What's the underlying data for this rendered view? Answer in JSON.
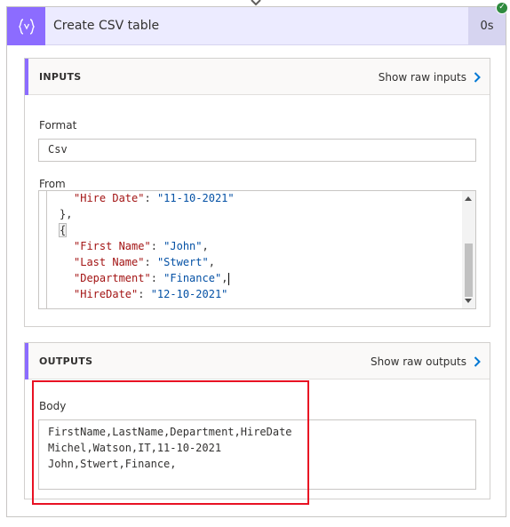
{
  "action": {
    "title": "Create CSV table",
    "duration": "0s",
    "icon": "curly-braces-variable-icon",
    "accent_color": "#8c6cff",
    "status": "succeeded",
    "status_color": "#2e8a3e"
  },
  "inputs": {
    "section_title": "INPUTS",
    "raw_link": "Show raw inputs",
    "format_label": "Format",
    "format_value": "Csv",
    "from_label": "From",
    "from_lines": [
      [
        {
          "t": "\"Hire Date\"",
          "c": "k"
        },
        {
          "t": ": ",
          "c": "p"
        },
        {
          "t": "\"11-10-2021\"",
          "c": "s"
        }
      ],
      [
        {
          "t": "},",
          "c": "p"
        }
      ],
      [
        {
          "t": "{",
          "c": "p"
        }
      ],
      [
        {
          "t": "\"First Name\"",
          "c": "k"
        },
        {
          "t": ": ",
          "c": "p"
        },
        {
          "t": "\"John\"",
          "c": "s"
        },
        {
          "t": ",",
          "c": "p"
        }
      ],
      [
        {
          "t": "\"Last Name\"",
          "c": "k"
        },
        {
          "t": ": ",
          "c": "p"
        },
        {
          "t": "\"Stwert\"",
          "c": "s"
        },
        {
          "t": ",",
          "c": "p"
        }
      ],
      [
        {
          "t": "\"Department\"",
          "c": "k"
        },
        {
          "t": ": ",
          "c": "p"
        },
        {
          "t": "\"Finance\"",
          "c": "s"
        },
        {
          "t": ",",
          "c": "p"
        }
      ],
      [
        {
          "t": "\"HireDate\"",
          "c": "k"
        },
        {
          "t": ": ",
          "c": "p"
        },
        {
          "t": "\"12-10-2021\"",
          "c": "s"
        }
      ]
    ]
  },
  "outputs": {
    "section_title": "OUTPUTS",
    "raw_link": "Show raw outputs",
    "body_label": "Body",
    "body_lines": [
      "FirstName,LastName,Department,HireDate",
      "Michel,Watson,IT,11-10-2021",
      "John,Stwert,Finance,"
    ]
  },
  "annotation": {
    "highlight_color": "#e81123"
  }
}
